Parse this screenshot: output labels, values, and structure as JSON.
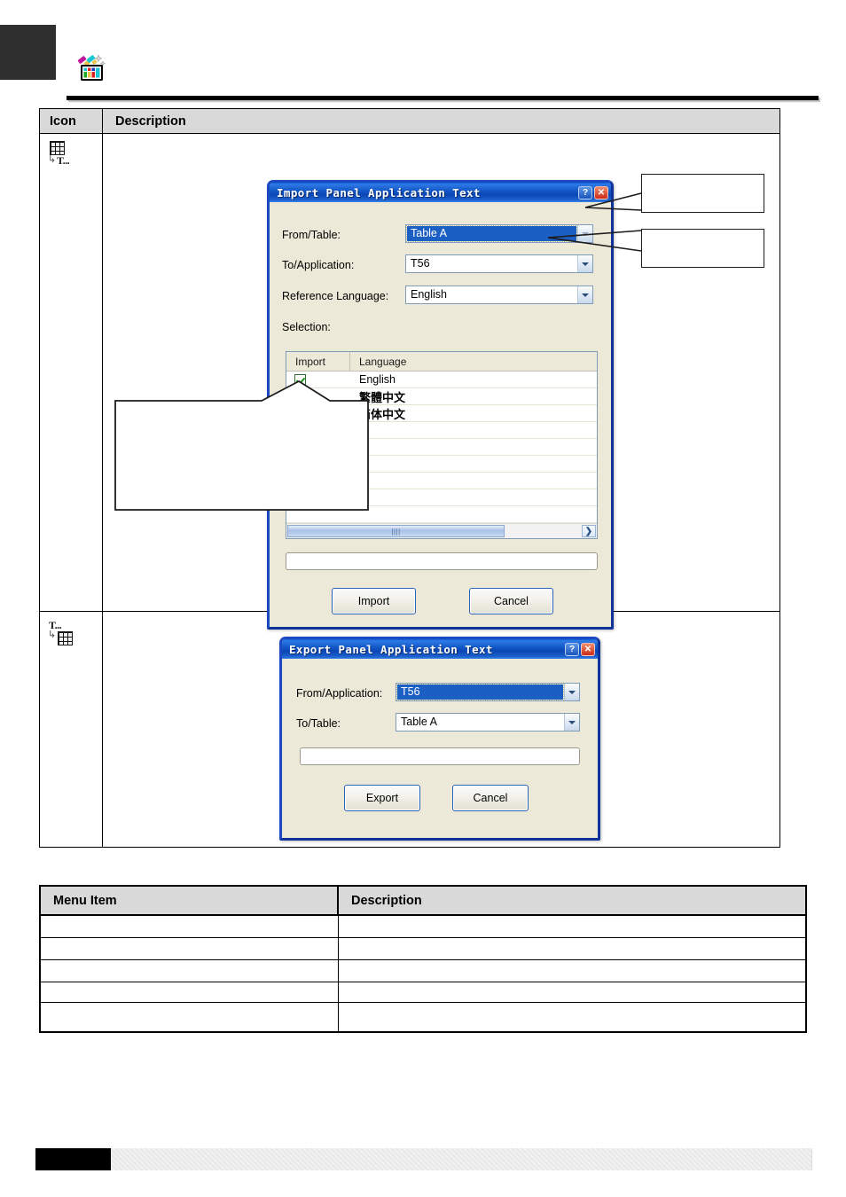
{
  "header": {
    "icon_name": "panel-text-palette-icon"
  },
  "icon_table": {
    "headers": {
      "icon": "Icon",
      "description": "Description"
    },
    "rows": [
      {
        "icon_name": "table-to-text-icon",
        "description": ""
      },
      {
        "icon_name": "text-to-table-icon",
        "description": ""
      }
    ]
  },
  "import_dialog": {
    "title": "Import Panel Application Text",
    "help_button": "?",
    "close_button": "✕",
    "fields": {
      "from_table_label": "From/Table:",
      "from_table_value": "Table  A",
      "to_application_label": "To/Application:",
      "to_application_value": "T56",
      "reference_language_label": "Reference Language:",
      "reference_language_value": "English",
      "selection_label": "Selection:"
    },
    "selection_list": {
      "columns": [
        "Import",
        "Language"
      ],
      "rows": [
        {
          "checked": true,
          "language": "English",
          "cjk": false
        },
        {
          "checked": true,
          "language": "繁體中文",
          "cjk": true
        },
        {
          "checked": true,
          "language": "简体中文",
          "cjk": true
        }
      ],
      "scroll_right_arrow": "❯"
    },
    "path_field_value": "",
    "buttons": {
      "primary": "Import",
      "cancel": "Cancel"
    }
  },
  "export_dialog": {
    "title": "Export Panel Application Text",
    "help_button": "?",
    "close_button": "✕",
    "fields": {
      "from_application_label": "From/Application:",
      "from_application_value": "T56",
      "to_table_label": "To/Table:",
      "to_table_value": "Table  A"
    },
    "path_field_value": "",
    "buttons": {
      "primary": "Export",
      "cancel": "Cancel"
    }
  },
  "callouts": [
    {
      "name": "callout-from-table",
      "text": ""
    },
    {
      "name": "callout-to-application",
      "text": ""
    },
    {
      "name": "callout-selection-list",
      "text": ""
    }
  ],
  "menu_table": {
    "headers": {
      "menu_item": "Menu Item",
      "description": "Description"
    },
    "rows": [
      {
        "menu_item": "",
        "description": ""
      },
      {
        "menu_item": "",
        "description": ""
      },
      {
        "menu_item": "",
        "description": ""
      },
      {
        "menu_item": "",
        "description": ""
      },
      {
        "menu_item": "",
        "description": ""
      }
    ]
  },
  "colors": {
    "dialog_face": "#ece9d8",
    "title_blue": "#0b46b4",
    "selection_blue": "#1c5fc4",
    "check_green": "#149414",
    "table_header_grey": "#d9d9d9"
  }
}
